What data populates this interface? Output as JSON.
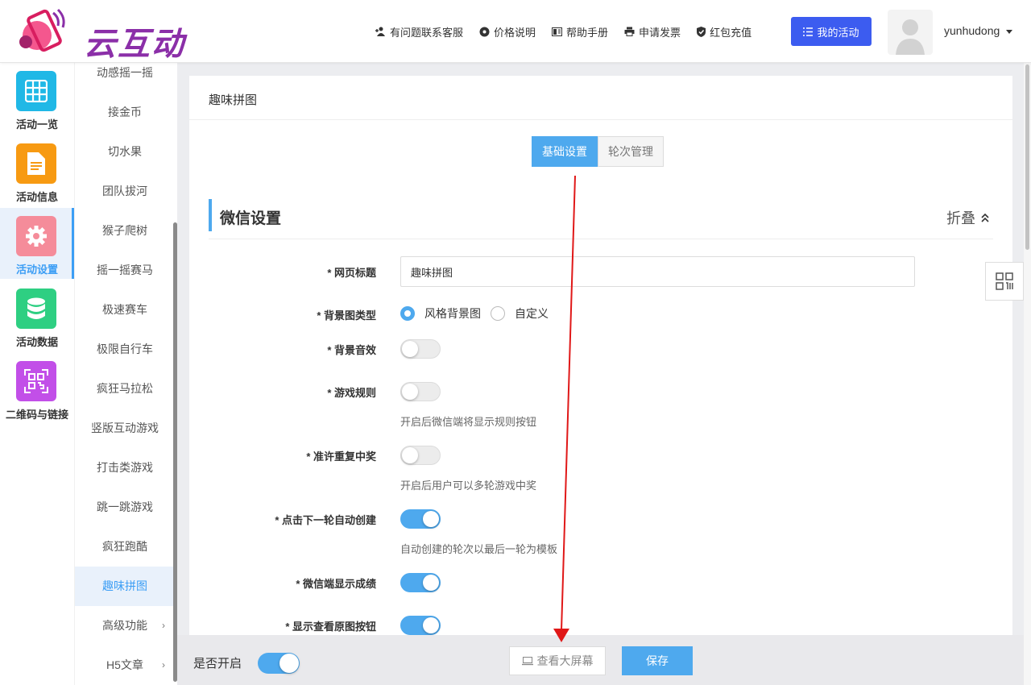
{
  "header": {
    "logo_text": "云互动",
    "nav": [
      {
        "label": "有问题联系客服",
        "icon": "add-user-icon"
      },
      {
        "label": "价格说明",
        "icon": "badge-icon"
      },
      {
        "label": "帮助手册",
        "icon": "book-icon"
      },
      {
        "label": "申请发票",
        "icon": "printer-icon"
      },
      {
        "label": "红包充值",
        "icon": "shield-check-icon"
      }
    ],
    "my_activity": "我的活动",
    "username": "yunhudong"
  },
  "leftnav": [
    {
      "label": "活动一览",
      "icon": "grid-icon",
      "color": "#20b8e6"
    },
    {
      "label": "活动信息",
      "icon": "document-icon",
      "color": "#f79a12"
    },
    {
      "label": "活动设置",
      "icon": "gear-icon",
      "color": "#f58c9a",
      "active": true
    },
    {
      "label": "活动数据",
      "icon": "database-icon",
      "color": "#2ecf82"
    },
    {
      "label": "二维码与链接",
      "icon": "qrcode-icon",
      "color": "#c24fe8"
    }
  ],
  "subnav": [
    "动感摇一摇",
    "接金币",
    "切水果",
    "团队拔河",
    "猴子爬树",
    "摇一摇赛马",
    "极速赛车",
    "极限自行车",
    "疯狂马拉松",
    "竖版互动游戏",
    "打击类游戏",
    "跳一跳游戏",
    "疯狂跑酷",
    "趣味拼图",
    "高级功能",
    "H5文章"
  ],
  "panel": {
    "title": "趣味拼图",
    "tabs": [
      "基础设置",
      "轮次管理"
    ],
    "section_title": "微信设置",
    "collapse_label": "折叠"
  },
  "form": {
    "page_title_label": "* 网页标题",
    "page_title_value": "趣味拼图",
    "bg_type_label": "* 背景图类型",
    "bg_type_options": [
      "风格背景图",
      "自定义"
    ],
    "bg_sound_label": "* 背景音效",
    "game_rules_label": "* 游戏规则",
    "game_rules_hint": "开启后微信端将显示规则按钮",
    "repeat_win_label": "* 准许重复中奖",
    "repeat_win_hint": "开启后用户可以多轮游戏中奖",
    "auto_create_label": "* 点击下一轮自动创建",
    "auto_create_hint": "自动创建的轮次以最后一轮为模板",
    "show_score_label": "* 微信端显示成绩",
    "show_original_label": "* 显示查看原图按钮"
  },
  "footer": {
    "enable_label": "是否开启",
    "view_screen": "查看大屏幕",
    "save": "保存"
  },
  "accent_color": "#4ea9ee"
}
